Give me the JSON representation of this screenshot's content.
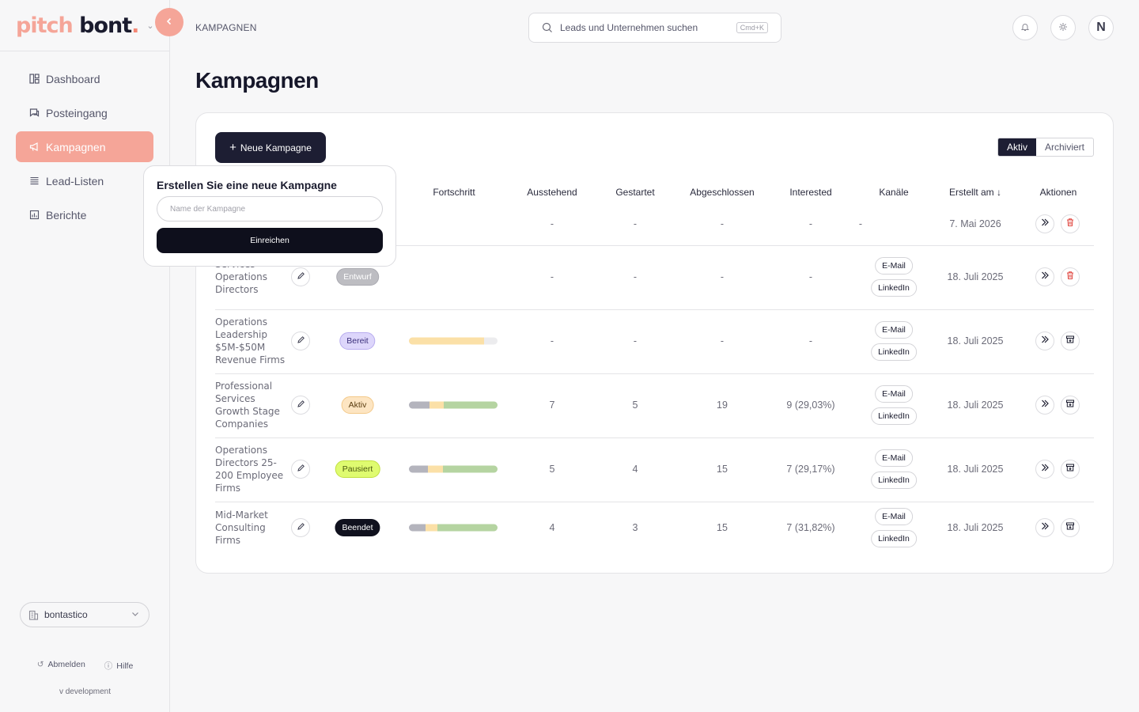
{
  "brand": {
    "part1": "pitch",
    "part2": " bont",
    "dot": "."
  },
  "sidebar": {
    "items": [
      {
        "label": "Dashboard",
        "icon": "dashboard-icon"
      },
      {
        "label": "Posteingang",
        "icon": "inbox-icon"
      },
      {
        "label": "Kampagnen",
        "icon": "megaphone-icon",
        "active": true
      },
      {
        "label": "Lead-Listen",
        "icon": "list-icon"
      },
      {
        "label": "Berichte",
        "icon": "chart-icon"
      }
    ],
    "org": "bontastico",
    "logout": "Abmelden",
    "help": "Hilfe",
    "version": "v development"
  },
  "header": {
    "breadcrumb": "KAMPAGNEN",
    "search_placeholder": "Leads und Unternehmen suchen",
    "search_shortcut": "Cmd+K",
    "avatar": "N"
  },
  "page": {
    "title": "Kampagnen"
  },
  "toolbar": {
    "new_campaign": "Neue Kampagne",
    "seg_active": "Aktiv",
    "seg_archived": "Archiviert"
  },
  "table": {
    "headers": {
      "progress": "Fortschritt",
      "pending": "Ausstehend",
      "started": "Gestartet",
      "completed": "Abgeschlossen",
      "interested": "Interested",
      "channels": "Kanäle",
      "created": "Erstellt am",
      "created_sort": "↓",
      "actions": "Aktionen"
    },
    "rows": [
      {
        "name": "",
        "status": "",
        "pending": "-",
        "started": "-",
        "completed": "-",
        "interested": "-",
        "channels_placeholder": "-",
        "created": "7. Mai 2026",
        "action2": "delete"
      },
      {
        "name": "Services Operations Directors",
        "status": "Entwurf",
        "pending": "-",
        "started": "-",
        "completed": "-",
        "interested": "-",
        "channels": [
          "E-Mail",
          "LinkedIn"
        ],
        "created": "18. Juli 2025",
        "action2": "delete"
      },
      {
        "name": "Operations Leadership $5M-$50M Revenue Firms",
        "status": "Bereit",
        "pending": "-",
        "started": "-",
        "completed": "-",
        "interested": "-",
        "channels": [
          "E-Mail",
          "LinkedIn"
        ],
        "created": "18. Juli 2025",
        "progress": {
          "pending": 0,
          "started": 0.85,
          "done": 0
        },
        "action2": "archive"
      },
      {
        "name": "Professional Services Growth Stage Companies",
        "status": "Aktiv",
        "pending": "7",
        "started": "5",
        "completed": "19",
        "interested": "9 (29,03%)",
        "channels": [
          "E-Mail",
          "LinkedIn"
        ],
        "created": "18. Juli 2025",
        "progress": {
          "pending": 0.23,
          "started": 0.16,
          "done": 0.61
        },
        "action2": "archive"
      },
      {
        "name": "Operations Directors 25-200 Employee Firms",
        "status": "Pausiert",
        "pending": "5",
        "started": "4",
        "completed": "15",
        "interested": "7 (29,17%)",
        "channels": [
          "E-Mail",
          "LinkedIn"
        ],
        "created": "18. Juli 2025",
        "progress": {
          "pending": 0.21,
          "started": 0.17,
          "done": 0.62
        },
        "action2": "archive"
      },
      {
        "name": "Mid-Market Consulting Firms",
        "status": "Beendet",
        "pending": "4",
        "started": "3",
        "completed": "15",
        "interested": "7 (31,82%)",
        "channels": [
          "E-Mail",
          "LinkedIn"
        ],
        "created": "18. Juli 2025",
        "progress": {
          "pending": 0.19,
          "started": 0.13,
          "done": 0.68
        },
        "action2": "archive"
      }
    ]
  },
  "popover": {
    "title": "Erstellen Sie eine neue Kampagne",
    "placeholder": "Name der Kampagne",
    "value": "",
    "submit": "Einreichen"
  },
  "colors": {
    "accent": "#f5a598",
    "dark": "#1d1e33",
    "pending": "#b4b4bd",
    "started": "#fbe0a7",
    "done": "#b5d4a1",
    "delete": "#e0453f"
  }
}
